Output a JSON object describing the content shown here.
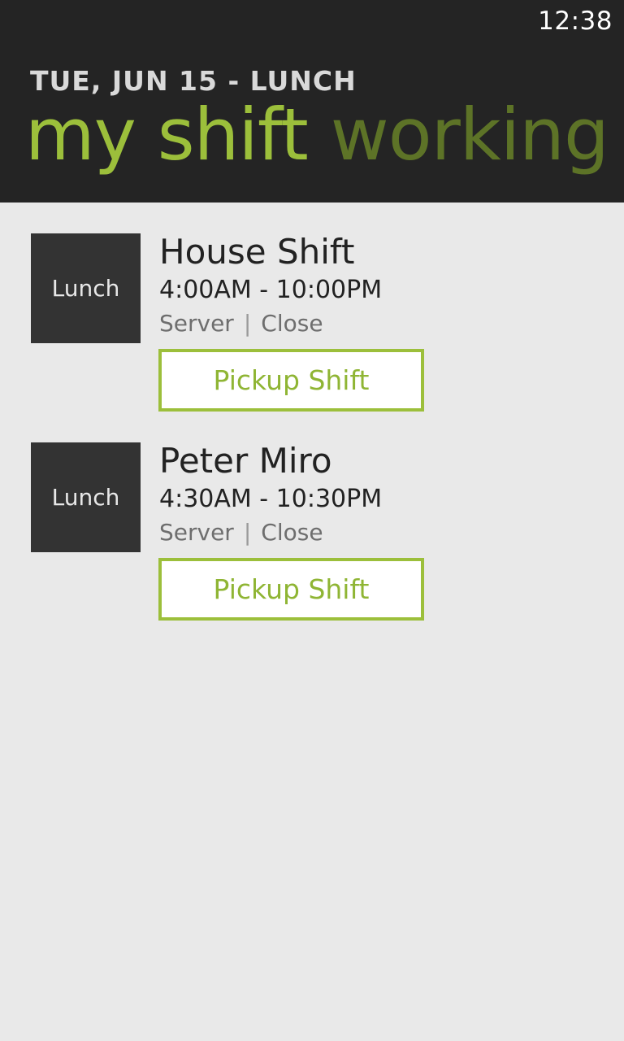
{
  "status_bar": {
    "time": "12:38"
  },
  "header": {
    "section_title": "TUE, JUN 15 - LUNCH",
    "pivots": [
      {
        "label": "my shift",
        "active": true
      },
      {
        "label": "working now",
        "active": false
      }
    ]
  },
  "shifts": [
    {
      "badge": "Lunch",
      "name": "House Shift",
      "time": "4:00AM - 10:00PM",
      "role": "Server",
      "separator": "|",
      "type": "Close",
      "action_label": "Pickup Shift"
    },
    {
      "badge": "Lunch",
      "name": "Peter Miro",
      "time": "4:30AM - 10:30PM",
      "role": "Server",
      "separator": "|",
      "type": "Close",
      "action_label": "Pickup Shift"
    }
  ],
  "colors": {
    "accent": "#9cbf3b",
    "accent_dim": "#5d7327",
    "header_bg": "#242424",
    "page_bg": "#e9e9e9",
    "badge_bg": "#333333"
  }
}
